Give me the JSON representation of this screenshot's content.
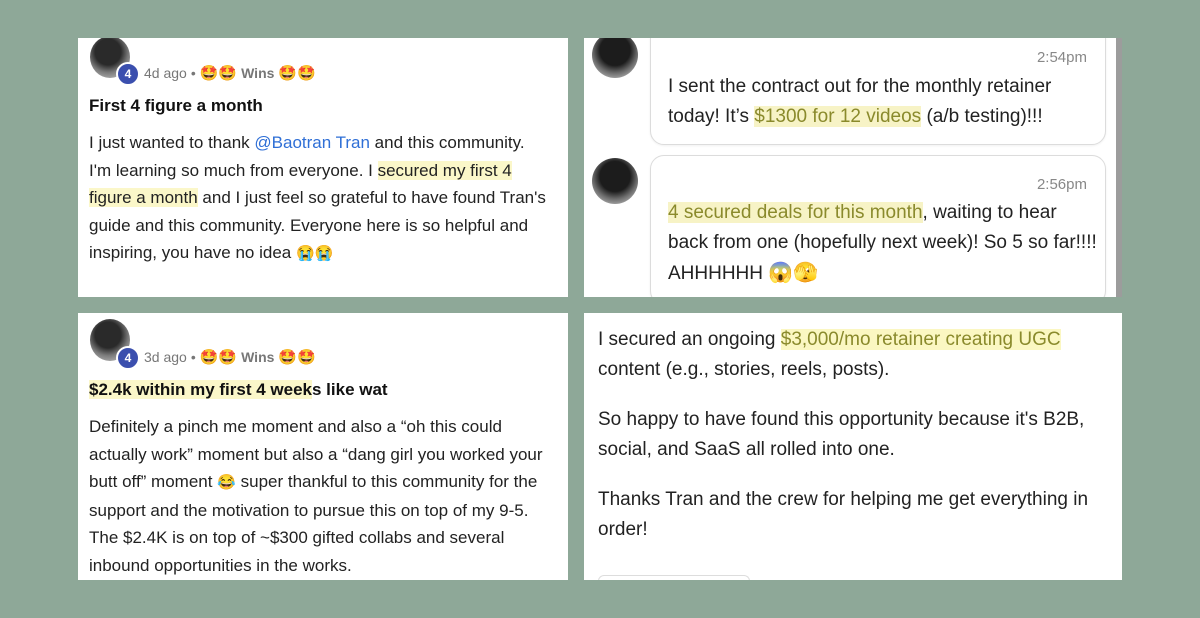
{
  "post1": {
    "level": "4",
    "time": "4d ago",
    "separator": "•",
    "emoji_left": "🤩🤩",
    "category": "Wins",
    "emoji_right": "🤩🤩",
    "title": "First 4 figure a month",
    "body": {
      "t1": "I just wanted to thank ",
      "mention": "@Baotran Tran",
      "t2": " and this community. I'm learning so much from everyone. I ",
      "highlight": "secured my first 4 figure a month",
      "t3": " and I just feel so grateful to have found Tran's guide and this community. Everyone here is so helpful and inspiring, you have no idea ",
      "emoji": "😭😭"
    }
  },
  "chat": {
    "msg1": {
      "time": "2:54pm",
      "t1": "I sent the contract out for the monthly retainer today! It’s ",
      "highlight": "$1300 for 12 videos",
      "t2": " (a/b testing)!!!"
    },
    "msg2": {
      "time": "2:56pm",
      "highlight": "4 secured deals for this month",
      "t1": ", waiting to hear back from one (hopefully next week)! So 5 so far!!!! AHHHHHH ",
      "emoji": "😱🫣"
    }
  },
  "post2": {
    "level": "4",
    "time": "3d ago",
    "separator": "•",
    "emoji_left": "🤩🤩",
    "category": "Wins",
    "emoji_right": "🤩🤩",
    "title_highlight": "$2.4k within my first 4 week",
    "title_rest": "s like wat",
    "body": {
      "t1": "Definitely a pinch me moment and also a “oh this could actually work” moment but also a “dang girl you worked your butt off” moment ",
      "emoji": "😂",
      "t2": " super thankful to this community for the support and the motivation to pursue this on top of my 9-5. The $2.4K is on top of ~$300 gifted collabs and several inbound opportunities in the works."
    }
  },
  "message4": {
    "p1_t1": "I secured an ongoing ",
    "p1_highlight": "$3,000/mo retainer creating UGC",
    "p1_t2": " content (e.g., stories, reels, posts).",
    "p2": "So happy to have found this opportunity because it's B2B, social, and SaaS all rolled into one.",
    "p3": "Thanks Tran and the crew for helping me get everything in order!"
  }
}
